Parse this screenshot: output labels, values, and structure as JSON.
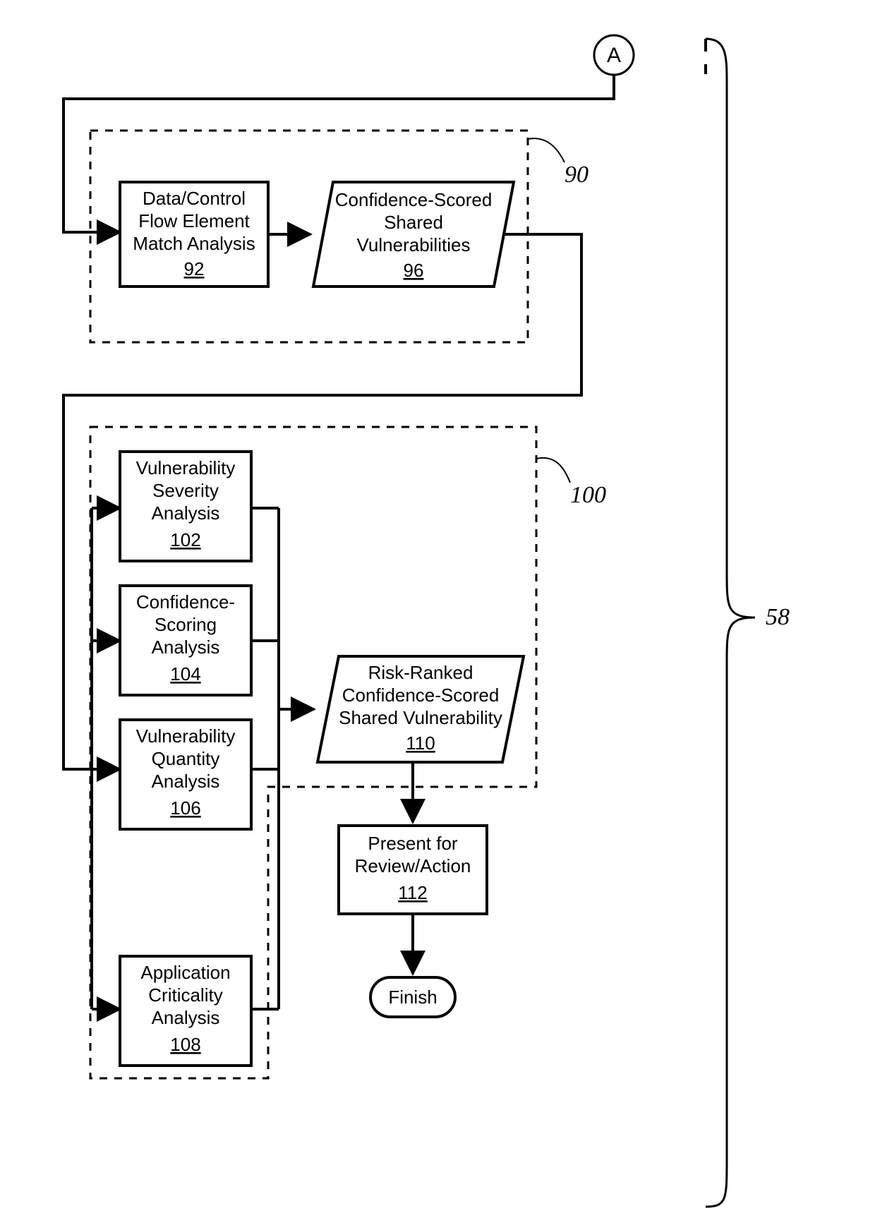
{
  "connector_label": "A",
  "brace_label": "58",
  "groups": {
    "group90": {
      "ref": "90"
    },
    "group100": {
      "ref": "100"
    }
  },
  "nodes": {
    "n92": {
      "lines": [
        "Data/Control",
        "Flow Element",
        "Match Analysis"
      ],
      "ref": "92"
    },
    "n96": {
      "lines": [
        "Confidence-Scored",
        "Shared",
        "Vulnerabilities"
      ],
      "ref": "96"
    },
    "n102": {
      "lines": [
        "Vulnerability",
        "Severity",
        "Analysis"
      ],
      "ref": "102"
    },
    "n104": {
      "lines": [
        "Confidence-",
        "Scoring",
        "Analysis"
      ],
      "ref": "104"
    },
    "n106": {
      "lines": [
        "Vulnerability",
        "Quantity",
        "Analysis"
      ],
      "ref": "106"
    },
    "n108": {
      "lines": [
        "Application",
        "Criticality",
        "Analysis"
      ],
      "ref": "108"
    },
    "n110": {
      "lines": [
        "Risk-Ranked",
        "Confidence-Scored",
        "Shared Vulnerability"
      ],
      "ref": "110"
    },
    "n112": {
      "lines": [
        "Present for",
        "Review/Action"
      ],
      "ref": "112"
    }
  },
  "terminator": "Finish"
}
